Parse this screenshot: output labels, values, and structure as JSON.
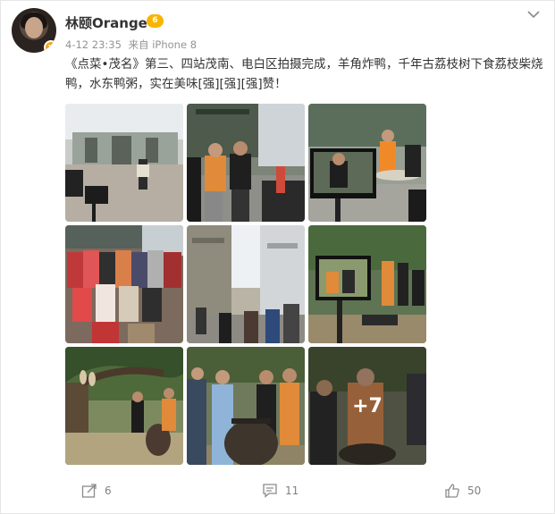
{
  "post": {
    "username": "林颐Orange",
    "vip_badge": "vip-level-icon",
    "timestamp": "4-12 23:35",
    "source": "来自 iPhone 8",
    "content": "《点菜•茂名》第三、四站茂南、电白区拍摄完成，羊角炸鸭，千年古荔枝树下食荔枝柴烧鸭，水东鸭粥，实在美味[强][强][强]赞！",
    "photos": [
      {
        "name": "photo-gate-plaza",
        "caption": ""
      },
      {
        "name": "photo-street-filming",
        "caption": ""
      },
      {
        "name": "photo-monitor-street",
        "caption": ""
      },
      {
        "name": "photo-crowd-group",
        "caption": ""
      },
      {
        "name": "photo-old-street",
        "caption": ""
      },
      {
        "name": "photo-monitor-tree",
        "caption": ""
      },
      {
        "name": "photo-lychee-tree",
        "caption": ""
      },
      {
        "name": "photo-group-jar",
        "caption": ""
      },
      {
        "name": "photo-more",
        "caption": "+7"
      }
    ]
  },
  "actions": {
    "share_count": "6",
    "comment_count": "11",
    "like_count": "50"
  },
  "icons": {
    "share": "share-icon",
    "comment": "comment-icon",
    "like": "like-icon",
    "menu": "chevron-down-icon"
  },
  "colors": {
    "text": "#333333",
    "meta": "#939393",
    "vip": "#f7b500"
  }
}
